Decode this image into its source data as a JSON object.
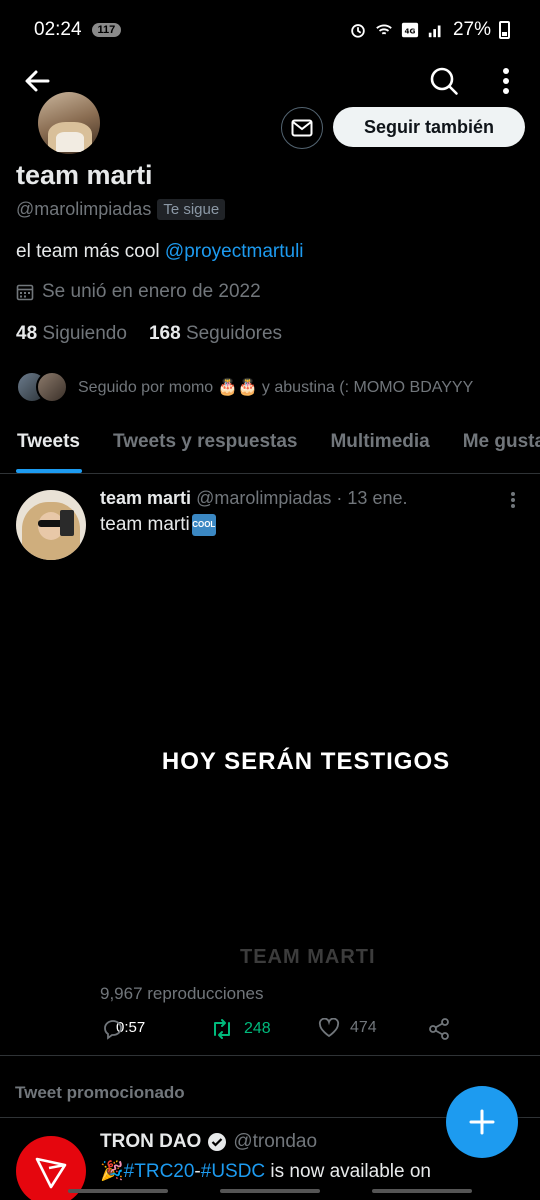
{
  "status_bar": {
    "time": "02:24",
    "notification_count": "117",
    "battery": "27%"
  },
  "profile": {
    "display_name": "team marti",
    "handle": "@marolimpiadas",
    "follows_you": "Te sigue",
    "bio_text": "el team más cool ",
    "bio_mention": "@proyectmartuli",
    "joined": "Se unió en enero de 2022",
    "following_count": "48",
    "following_label": "Siguiendo",
    "followers_count": "168",
    "followers_label": "Seguidores",
    "followed_by": "Seguido por momo 🎂🎂 y abustina (: MOMO BDAYYY",
    "follow_button": "Seguir también"
  },
  "tabs": [
    {
      "label": "Tweets"
    },
    {
      "label": "Tweets y respuestas"
    },
    {
      "label": "Multimedia"
    },
    {
      "label": "Me gusta"
    }
  ],
  "tweet": {
    "name": "team marti",
    "handle": "@marolimpiadas",
    "dot": "·",
    "date": "13 ene.",
    "text": "team marti",
    "cool_emoji": "COOL",
    "video_title": "HOY SERÁN TESTIGOS",
    "video_watermark": "TEAM MARTI",
    "video_duration": "0:57",
    "views": "9,967 reproducciones",
    "retweets": "248",
    "likes": "474"
  },
  "promoted": {
    "label": "Tweet promocionado",
    "name": "TRON DAO",
    "handle": "@trondao",
    "emoji": "🎉",
    "tag1": "#TRC20",
    "dash": "-",
    "tag2": "#USDC",
    "text_rest": " is now available on"
  },
  "icons": {
    "back": "back-arrow-icon",
    "search": "search-icon",
    "more": "more-vertical-icon",
    "message": "envelope-icon",
    "calendar": "calendar-icon",
    "reply": "reply-icon",
    "retweet": "retweet-icon",
    "like": "heart-icon",
    "share": "share-icon",
    "compose": "plus-icon",
    "verified": "verified-badge-icon"
  },
  "colors": {
    "accent": "#1d9bf0",
    "retweet_active": "#00ba7c",
    "background": "#000000",
    "secondary_text": "#71767b",
    "tron_red": "#e5060e"
  }
}
